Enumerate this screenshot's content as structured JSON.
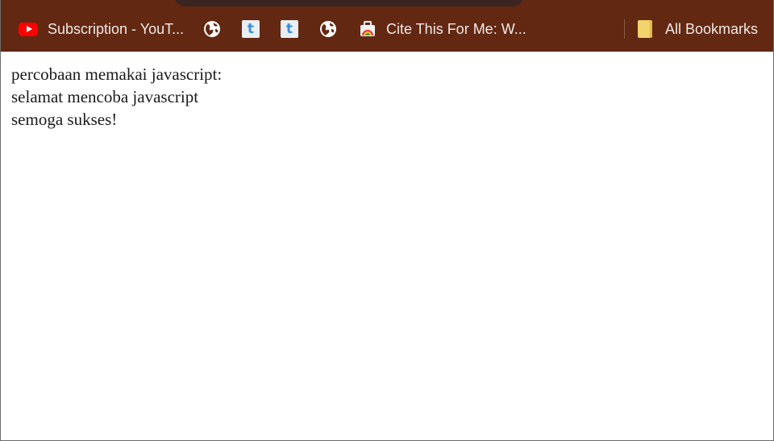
{
  "browser": {
    "bookmarks_bar": {
      "items": [
        {
          "label": "Subscription - YouT...",
          "icon": "youtube-icon"
        },
        {
          "label": "",
          "icon": "globe-icon"
        },
        {
          "label": "",
          "icon": "tumblr-icon",
          "glyph": "t"
        },
        {
          "label": "",
          "icon": "tumblr-icon",
          "glyph": "t"
        },
        {
          "label": "",
          "icon": "globe-icon"
        },
        {
          "label": "Cite This For Me: W...",
          "icon": "cite-this-for-me-icon"
        }
      ],
      "all_bookmarks": {
        "label": "All Bookmarks",
        "icon": "folder-icon"
      }
    },
    "colors": {
      "bar_background": "#632812",
      "bar_text": "#f1e9e6",
      "page_background": "#ffffff"
    }
  },
  "page": {
    "lines": [
      "percobaan memakai javascript:",
      "selamat mencoba javascript",
      "semoga sukses!"
    ]
  }
}
